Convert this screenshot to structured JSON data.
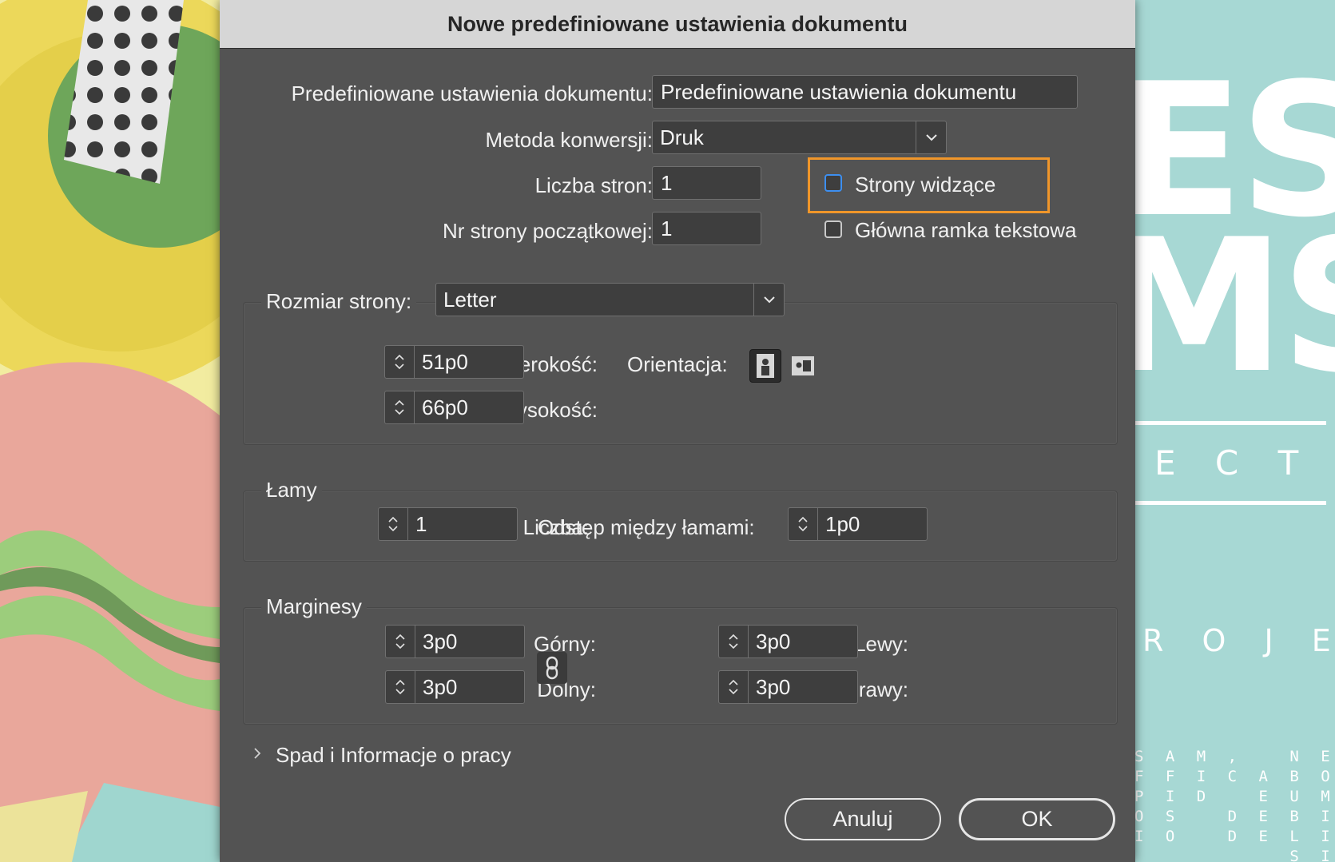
{
  "dialog": {
    "title": "Nowe predefiniowane ustawienia dokumentu",
    "preset_label": "Predefiniowane ustawienia dokumentu:",
    "preset_value": "Predefiniowane ustawienia dokumentu",
    "intent_label": "Metoda konwersji:",
    "intent_value": "Druk",
    "pages_label": "Liczba stron:",
    "pages_value": "1",
    "start_page_label": "Nr strony początkowej:",
    "start_page_value": "1",
    "facing_pages_label": "Strony widzące",
    "facing_pages_checked": false,
    "primary_text_frame_label": "Główna ramka tekstowa",
    "primary_text_frame_checked": false
  },
  "page_size": {
    "label": "Rozmiar strony:",
    "value": "Letter",
    "width_label": "Szerokość:",
    "width_value": "51p0",
    "height_label": "Wysokość:",
    "height_value": "66p0",
    "orientation_label": "Orientacja:",
    "orientation_selected": "portrait"
  },
  "columns": {
    "title": "Łamy",
    "number_label": "Liczba:",
    "number_value": "1",
    "gutter_label": "Odstęp między łamami:",
    "gutter_value": "1p0"
  },
  "margins": {
    "title": "Marginesy",
    "top_label": "Górny:",
    "top_value": "3p0",
    "bottom_label": "Dolny:",
    "bottom_value": "3p0",
    "left_label": "Lewy:",
    "left_value": "3p0",
    "right_label": "Prawy:",
    "right_value": "3p0"
  },
  "bleed": {
    "label": "Spad i Informacje o pracy",
    "expanded": false
  },
  "buttons": {
    "cancel": "Anuluj",
    "ok": "OK"
  },
  "background": {
    "big_top": "ES",
    "big_mid": "MS",
    "spaced_1": "E C T",
    "spaced_2": "R O J E C T",
    "small_text": "S A M ,   N E C A B   I S\nF F I C A B O .   N A M\nP I D   E U M   U T   I L\nO S   D E B I T A T E M\nI O   D E L I T   Q U I S\n          S I N C T A T"
  },
  "colors": {
    "highlight": "#f0962a",
    "checkbox_focus": "#3d8ff0",
    "dialog_bg": "#535353",
    "accent_bg": "#a7d8d4"
  }
}
